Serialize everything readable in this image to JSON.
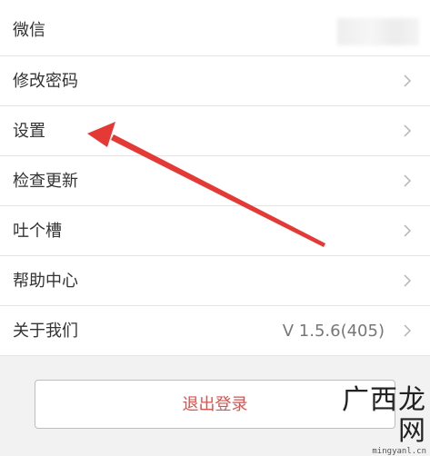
{
  "menu": {
    "items": [
      {
        "label": "微信",
        "value": ""
      },
      {
        "label": "修改密码",
        "value": ""
      },
      {
        "label": "设置",
        "value": ""
      },
      {
        "label": "检查更新",
        "value": ""
      },
      {
        "label": "吐个槽",
        "value": ""
      },
      {
        "label": "帮助中心",
        "value": ""
      },
      {
        "label": "关于我们",
        "value": "V 1.5.6(405)"
      }
    ]
  },
  "logout": {
    "label": "退出登录"
  },
  "watermark": {
    "text": "广西龙网",
    "url": "mingyanl.cn"
  },
  "colors": {
    "accent": "#d9534f",
    "arrow": "#e53935"
  },
  "icons": {
    "row_chevron": "chevron-right-icon",
    "annotation": "red-arrow"
  }
}
